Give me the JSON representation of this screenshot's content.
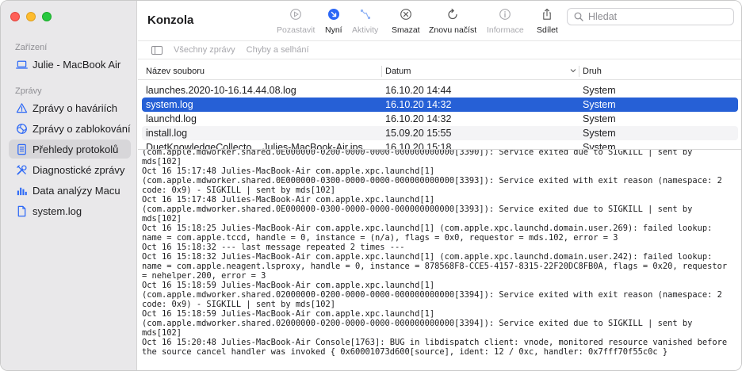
{
  "sidebar": {
    "section_devices": "Zařízení",
    "device": {
      "label": "Julie - MacBook Air",
      "icon": "laptop-icon"
    },
    "section_reports": "Zprávy",
    "items": [
      {
        "label": "Zprávy o haváriích",
        "icon": "warning-icon"
      },
      {
        "label": "Zprávy o zablokování",
        "icon": "spinner-icon"
      },
      {
        "label": "Přehledy protokolů",
        "icon": "document-icon",
        "selected": true
      },
      {
        "label": "Diagnostické zprávy",
        "icon": "tools-icon"
      },
      {
        "label": "Data analýzy Macu",
        "icon": "chart-icon"
      },
      {
        "label": "system.log",
        "icon": "file-icon"
      }
    ]
  },
  "toolbar": {
    "title": "Konzola",
    "pause": "Pozastavit",
    "now": "Nyní",
    "activity": "Aktivity",
    "clear": "Smazat",
    "reload": "Znovu načíst",
    "info": "Informace",
    "share": "Sdílet",
    "search_placeholder": "Hledat"
  },
  "filters": {
    "all": "Všechny zprávy",
    "errors": "Chyby a selhání"
  },
  "table": {
    "columns": {
      "name": "Název souboru",
      "date": "Datum",
      "kind": "Druh"
    },
    "rows": [
      {
        "name": "launches.2020-10-16.14.44.08.log",
        "date": "16.10.20 14:44",
        "kind": "System"
      },
      {
        "name": "system.log",
        "date": "16.10.20 14:32",
        "kind": "System",
        "selected": true
      },
      {
        "name": "launchd.log",
        "date": "16.10.20 14:32",
        "kind": "System"
      },
      {
        "name": "install.log",
        "date": "15.09.20 15:55",
        "kind": "System"
      },
      {
        "name": "DuetKnowledgeCollecto... Julies-MacBook-Air.ips",
        "date": "16.10.20 15:18",
        "kind": "System"
      }
    ]
  },
  "log": {
    "lines": [
      "(com.apple.mdworker.shared.0E000000-0200-0000-0000-000000000000[3390]): Service exited due to SIGKILL | sent by",
      "mds[102]",
      "Oct 16 15:17:48 Julies-MacBook-Air com.apple.xpc.launchd[1]",
      "(com.apple.mdworker.shared.0E000000-0300-0000-0000-000000000000[3393]): Service exited with exit reason (namespace: 2",
      "code: 0x9) - SIGKILL | sent by mds[102]",
      "Oct 16 15:17:48 Julies-MacBook-Air com.apple.xpc.launchd[1]",
      "(com.apple.mdworker.shared.0E000000-0300-0000-0000-000000000000[3393]): Service exited due to SIGKILL | sent by",
      "mds[102]",
      "Oct 16 15:18:25 Julies-MacBook-Air com.apple.xpc.launchd[1] (com.apple.xpc.launchd.domain.user.269): failed lookup:",
      "name = com.apple.tccd, handle = 0, instance = (n/a), flags = 0x0, requestor = mds.102, error = 3",
      "Oct 16 15:18:32 --- last message repeated 2 times ---",
      "Oct 16 15:18:32 Julies-MacBook-Air com.apple.xpc.launchd[1] (com.apple.xpc.launchd.domain.user.242): failed lookup:",
      "name = com.apple.neagent.lsproxy, handle = 0, instance = 878568F8-CCE5-4157-8315-22F20DC8FB0A, flags = 0x20, requestor",
      "= nehelper.200, error = 3",
      "Oct 16 15:18:59 Julies-MacBook-Air com.apple.xpc.launchd[1]",
      "(com.apple.mdworker.shared.02000000-0200-0000-0000-000000000000[3394]): Service exited with exit reason (namespace: 2",
      "code: 0x9) - SIGKILL | sent by mds[102]",
      "Oct 16 15:18:59 Julies-MacBook-Air com.apple.xpc.launchd[1]",
      "(com.apple.mdworker.shared.02000000-0200-0000-0000-000000000000[3394]): Service exited due to SIGKILL | sent by",
      "mds[102]",
      "Oct 16 15:20:48 Julies-MacBook-Air Console[1763]: BUG in libdispatch client: vnode, monitored resource vanished before",
      "the source cancel handler was invoked { 0x60001073d600[source], ident: 12 / 0xc, handler: 0x7fff70f55c0c }"
    ]
  }
}
